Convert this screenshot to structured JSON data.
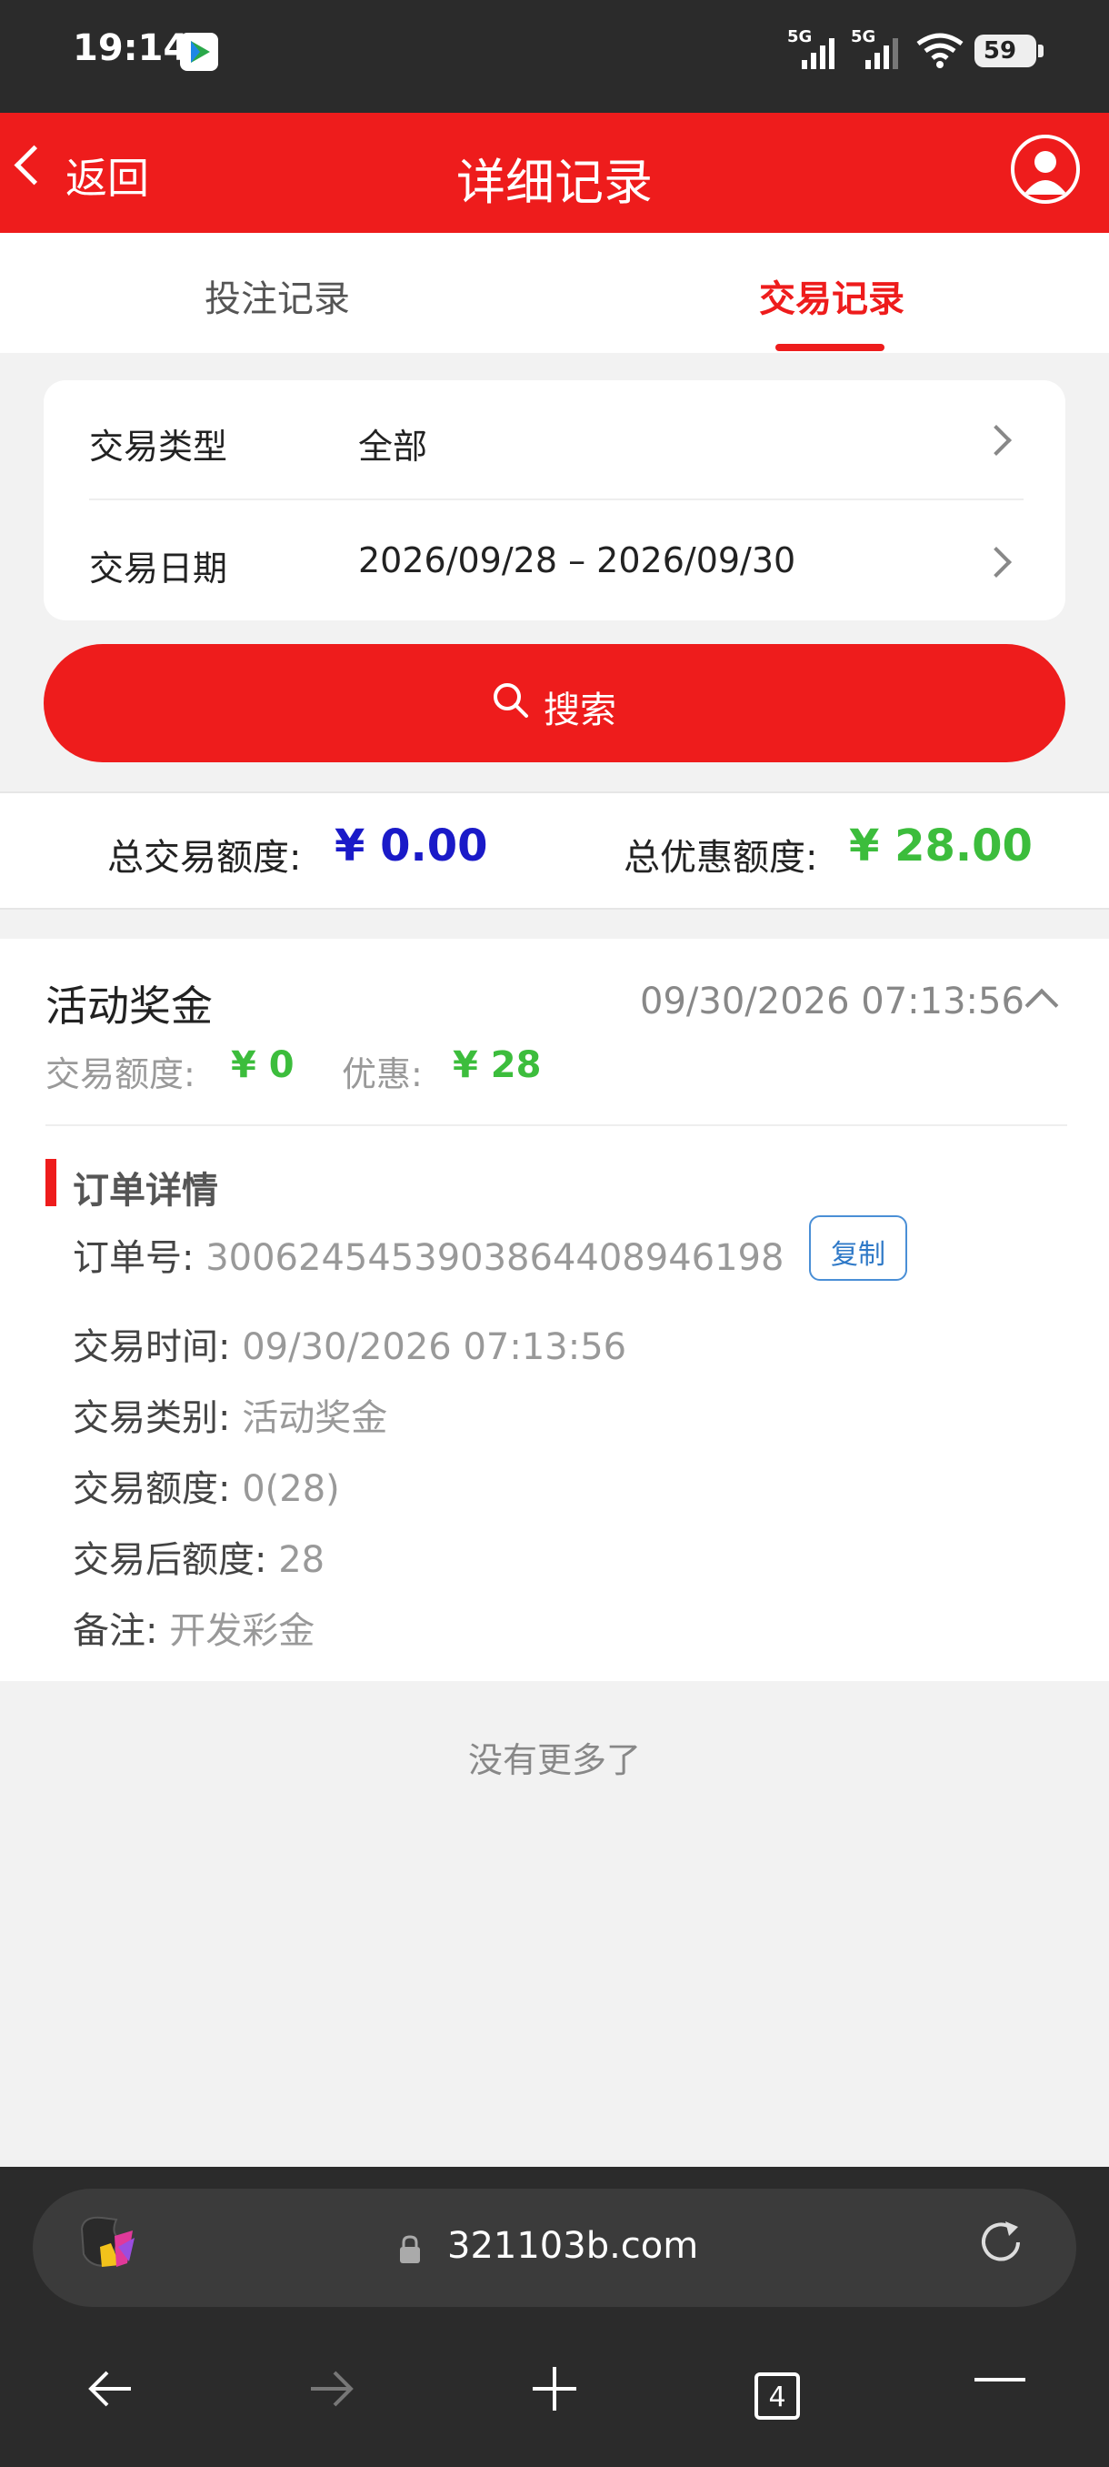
{
  "status_bar": {
    "time": "19:14",
    "signal1_label": "5G",
    "signal2_label": "5G",
    "battery_level": "59"
  },
  "header": {
    "back_label": "返回",
    "title": "详细记录"
  },
  "tabs": [
    {
      "label": "投注记录",
      "active": false
    },
    {
      "label": "交易记录",
      "active": true
    }
  ],
  "filter": {
    "type_label": "交易类型",
    "type_value": "全部",
    "date_label": "交易日期",
    "date_value": "2026/09/28 – 2026/09/30"
  },
  "search": {
    "label": "搜索"
  },
  "totals": {
    "trade_label": "总交易额度:",
    "trade_value": "¥ 0.00",
    "discount_label": "总优惠额度:",
    "discount_value": "¥ 28.00",
    "trade_color": "#1a1ac8",
    "discount_color": "#3cbd3c"
  },
  "record": {
    "title": "活动奖金",
    "time": "09/30/2026 07:13:56",
    "amount_label": "交易额度:",
    "amount_value": "¥ 0",
    "discount_label": "优惠:",
    "discount_value": "¥ 28",
    "detail_heading": "订单详情",
    "order_no_label": "订单号:",
    "order_no": "30062454539038644089461​98",
    "copy_label": "复制",
    "trade_time_label": "交易时间:",
    "trade_time": "09/30/2026 07:13:56",
    "trade_category_label": "交易类别:",
    "trade_category": "活动奖金",
    "trade_amount_label": "交易额度:",
    "trade_amount": "0(28)",
    "after_amount_label": "交易后额度:",
    "after_amount": "28",
    "remark_label": "备注:",
    "remark": "开发彩金"
  },
  "list_end_text": "没有更多了",
  "browser": {
    "url": "321103b.com",
    "tab_count": "4"
  },
  "colors": {
    "brand_red": "#ee1c1c",
    "positive_green": "#3cbd3c",
    "total_blue": "#1a1ac8"
  }
}
